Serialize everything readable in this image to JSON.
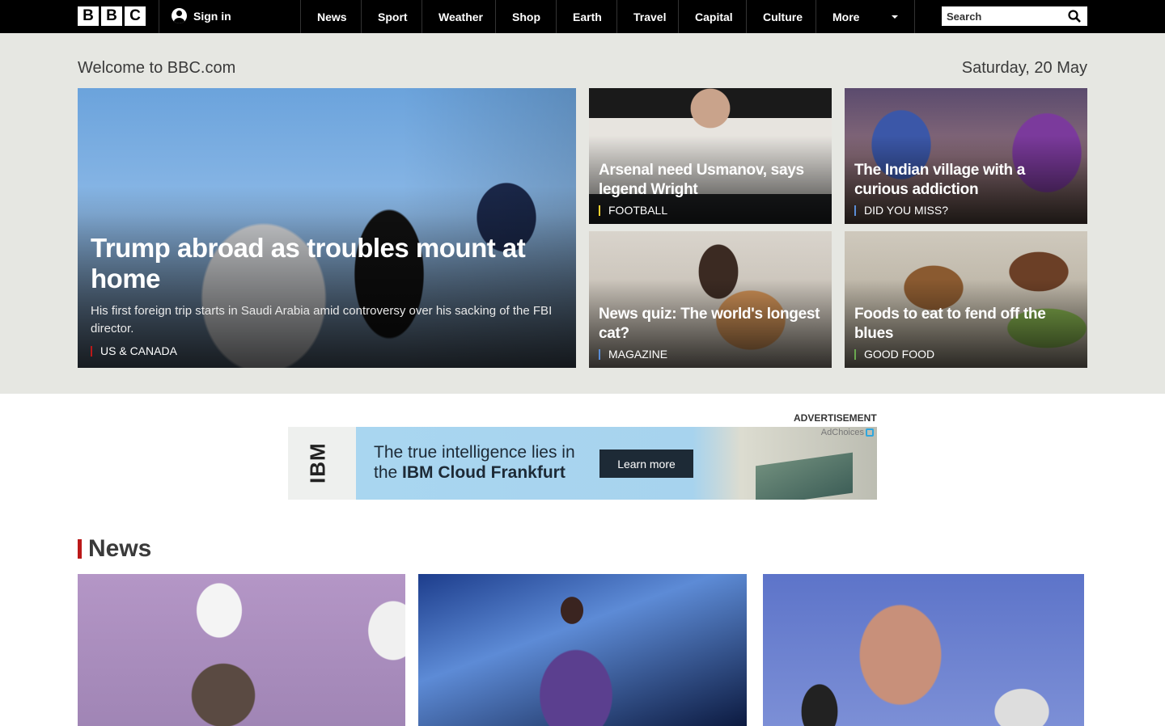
{
  "header": {
    "logo_letters": [
      "B",
      "B",
      "C"
    ],
    "signin_label": "Sign in",
    "nav": [
      "News",
      "Sport",
      "Weather",
      "Shop",
      "Earth",
      "Travel",
      "Capital",
      "Culture",
      "More"
    ],
    "search_placeholder": "Search"
  },
  "welcome": {
    "title": "Welcome to BBC.com",
    "date": "Saturday, 20 May"
  },
  "stories": {
    "main": {
      "headline": "Trump abroad as troubles mount at home",
      "summary": "His first foreign trip starts in Saudi Arabia amid controversy over his sacking of the FBI director.",
      "tag": "US & CANADA",
      "tag_color": "#bb1919"
    },
    "s1": {
      "headline": "Arsenal need Usmanov, says legend Wright",
      "tag": "FOOTBALL",
      "tag_color": "#ffd230"
    },
    "s2": {
      "headline": "The Indian village with a curious addiction",
      "tag": "DID YOU MISS?",
      "tag_color": "#5a8dd6"
    },
    "s3": {
      "headline": "News quiz: The world's longest cat?",
      "tag": "MAGAZINE",
      "tag_color": "#5a8dd6"
    },
    "s4": {
      "headline": "Foods to eat to fend off the blues",
      "tag": "GOOD FOOD",
      "tag_color": "#6aa84f"
    }
  },
  "advert": {
    "label": "ADVERTISEMENT",
    "brand": "IBM",
    "line1": "The true intelligence lies in",
    "line2_prefix": "the ",
    "line2_bold": "IBM Cloud Frankfurt",
    "cta": "Learn more",
    "adchoices": "AdChoices"
  },
  "news": {
    "title": "News",
    "accent": "#bb1919"
  },
  "colors": {
    "topbar": "#000000",
    "hero_bg": "#e6e7e2"
  }
}
